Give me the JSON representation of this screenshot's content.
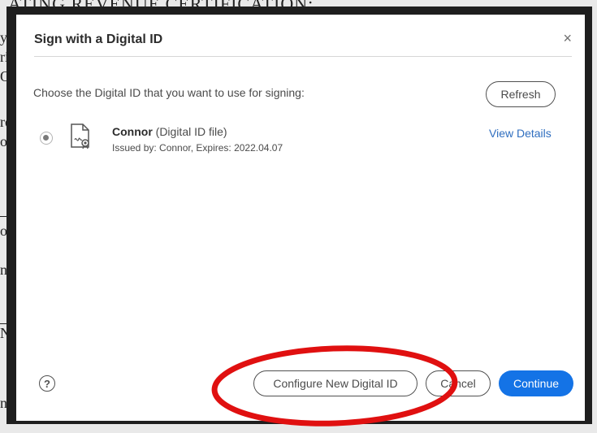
{
  "background_document": {
    "heading": "ATING REVENUE CERTIFICATION:",
    "fragments": [
      "y c",
      "riv",
      "OI",
      "re",
      "os",
      "or",
      "ni",
      "N",
      "no"
    ]
  },
  "dialog": {
    "title": "Sign with a Digital ID",
    "close_glyph": "×",
    "prompt": "Choose the Digital ID that you want to use for signing:",
    "refresh_label": "Refresh",
    "digital_ids": [
      {
        "name": "Connor",
        "type": "(Digital ID file)",
        "issued": "Issued by: Connor, Expires: 2022.04.07",
        "selected": true,
        "icon": "certificate-file-icon",
        "view_details_label": "View Details"
      }
    ],
    "help_glyph": "?",
    "configure_label": "Configure New Digital ID",
    "cancel_label": "Cancel",
    "continue_label": "Continue"
  },
  "colors": {
    "primary_button": "#1473e6",
    "link": "#2f6ebf",
    "annotation_ellipse": "#e01010"
  }
}
